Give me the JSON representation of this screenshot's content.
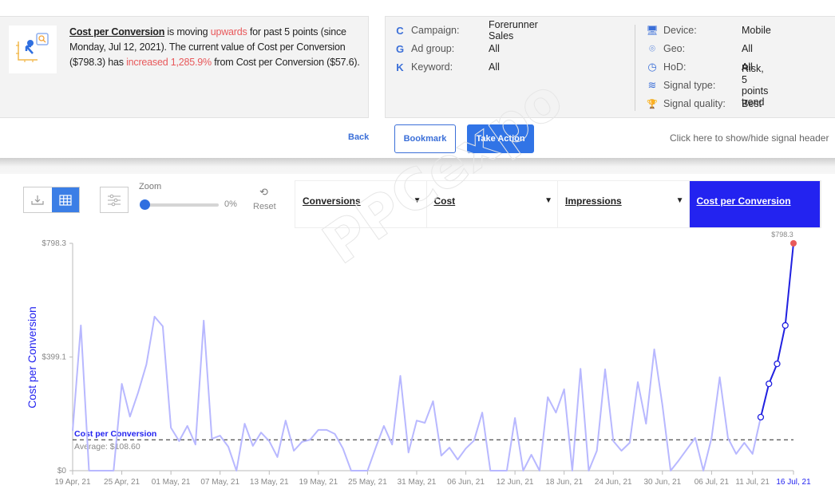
{
  "signal": {
    "metric": "Cost per Conversion",
    "t1": " is moving ",
    "direction": "upwards",
    "t2": " for past 5 points (since Monday, Jul 12, 2021). The current value of Cost per Conversion ($798.3) has ",
    "change": "increased 1,285.9%",
    "t3": " from Cost per Conversion ($57.6)."
  },
  "meta_left": [
    {
      "icon": "C",
      "icon_name": "campaign-icon",
      "label": "Campaign:",
      "value": "Forerunner Sales"
    },
    {
      "icon": "G",
      "icon_name": "ad-group-icon",
      "label": "Ad group:",
      "value": "All"
    },
    {
      "icon": "K",
      "icon_name": "keyword-icon",
      "label": "Keyword:",
      "value": "All"
    }
  ],
  "meta_right": [
    {
      "icon": "🖥",
      "icon_name": "device-icon",
      "label": "Device:",
      "value": "Mobile"
    },
    {
      "icon": "⌾",
      "icon_name": "geo-pin-icon",
      "label": "Geo:",
      "value": "All"
    },
    {
      "icon": "◷",
      "icon_name": "clock-icon",
      "label": "HoD:",
      "value": "All"
    },
    {
      "icon": "≋",
      "icon_name": "signal-icon",
      "label": "Signal type:",
      "value": "Risk, 5 points trend"
    },
    {
      "icon": "🏆",
      "icon_name": "trophy-icon",
      "label": "Signal quality:",
      "value": "Best"
    }
  ],
  "actions": {
    "back": "Back",
    "bookmark": "Bookmark",
    "take_action": "Take Action",
    "toggle_header": "Click here to show/hide signal header"
  },
  "toolbar": {
    "zoom_label": "Zoom",
    "zoom_value": "0%",
    "zoom_fraction": 0,
    "reset_label": "Reset"
  },
  "metric_tabs": [
    {
      "label": "Conversions",
      "active": false
    },
    {
      "label": "Cost",
      "active": false
    },
    {
      "label": "Impressions",
      "active": false
    },
    {
      "label": "Cost per Conversion",
      "active": true
    }
  ],
  "watermark": "PPCexpo",
  "colors": {
    "accent": "#2323f0",
    "line_light": "#b8b8ff",
    "line_trend": "#2020e0",
    "last_point": "#e8595b",
    "button_blue": "#3174e6"
  },
  "chart_data": {
    "type": "line",
    "title": "",
    "xlabel": "",
    "ylabel": "Cost per Conversion",
    "ylim": [
      0,
      798.3
    ],
    "y_ticks": [
      "$0",
      "$399.1",
      "$798.3"
    ],
    "y_tick_values": [
      0,
      399.1,
      798.3
    ],
    "start_date": "19 Apr, 21",
    "x_tick_labels": [
      "19 Apr, 21",
      "25 Apr, 21",
      "01 May, 21",
      "07 May, 21",
      "13 May, 21",
      "19 May, 21",
      "25 May, 21",
      "31 May, 21",
      "06 Jun, 21",
      "12 Jun, 21",
      "18 Jun, 21",
      "24 Jun, 21",
      "30 Jun, 21",
      "06 Jul, 21",
      "11 Jul, 21",
      "16 Jul, 21"
    ],
    "x_tick_index": [
      0,
      6,
      12,
      18,
      24,
      30,
      36,
      42,
      48,
      54,
      60,
      66,
      72,
      78,
      83,
      88
    ],
    "average": {
      "label": "Cost per Conversion",
      "text": "Average: $108.60",
      "value": 108.6
    },
    "last_value_label": "$798.3",
    "trend_start_index": 84,
    "series": [
      {
        "name": "Cost per Conversion",
        "values": [
          140,
          510,
          0,
          0,
          0,
          0,
          305,
          190,
          275,
          373,
          541,
          507,
          151,
          104,
          157,
          92,
          527,
          112,
          123,
          84,
          0,
          165,
          87,
          134,
          104,
          48,
          176,
          70,
          101,
          109,
          143,
          143,
          129,
          78,
          0,
          0,
          0,
          81,
          157,
          92,
          333,
          64,
          176,
          168,
          244,
          53,
          81,
          39,
          78,
          106,
          204,
          0,
          0,
          0,
          185,
          0,
          56,
          0,
          258,
          204,
          286,
          0,
          358,
          0,
          70,
          356,
          104,
          70,
          98,
          311,
          165,
          426,
          230,
          0,
          36,
          76,
          115,
          0,
          115,
          328,
          115,
          59,
          98,
          59,
          188,
          305,
          375,
          510,
          798.3
        ]
      }
    ]
  }
}
